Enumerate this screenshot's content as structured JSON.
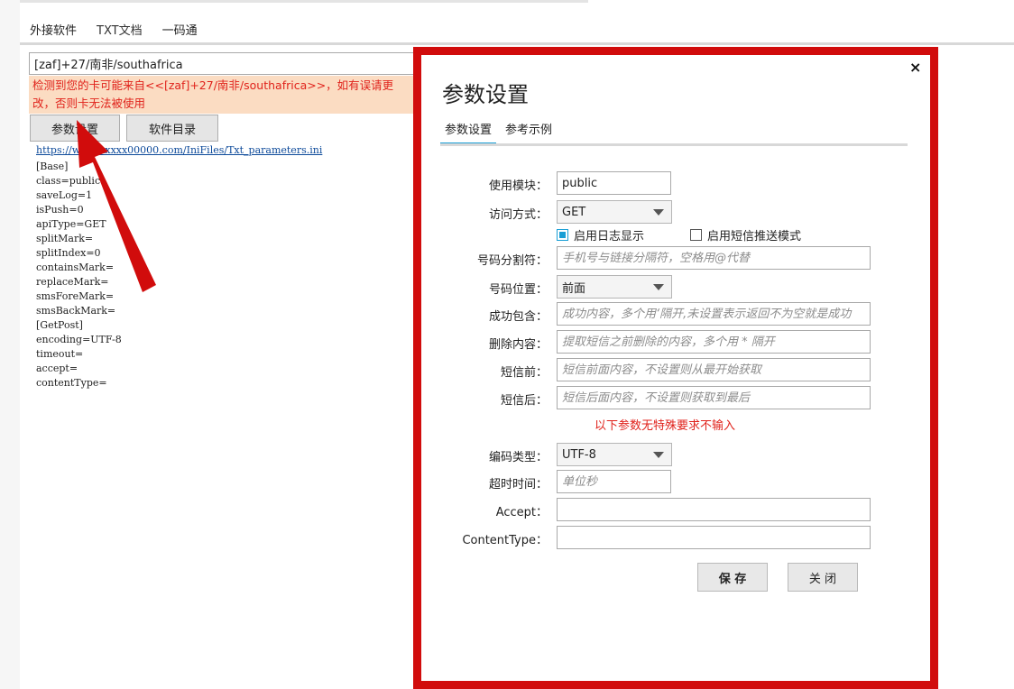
{
  "tabs": [
    "外接软件",
    "TXT文档",
    "一码通"
  ],
  "left_panel": {
    "source_value": "[zaf]+27/南非/southafrica",
    "warning_text": "检测到您的卡可能来自<<[zaf]+27/南非/southafrica>>，如有误请更改，否则卡无法被使用",
    "param_button": "参数设置",
    "dir_button": "软件目录",
    "config_link": "https://www.xxxxx00000.com/IniFiles/Txt_parameters.ini",
    "ini_lines": [
      "[Base]",
      "class=public",
      "saveLog=1",
      "isPush=0",
      "apiType=GET",
      "splitMark=",
      "splitIndex=0",
      "containsMark=",
      "replaceMark=",
      "smsForeMark=",
      "smsBackMark=",
      "[GetPost]",
      "encoding=UTF-8",
      "timeout=",
      "accept=",
      "contentType="
    ]
  },
  "dialog": {
    "title": "参数设置",
    "close_glyph": "×",
    "tabs": [
      "参数设置",
      "参考示例"
    ],
    "labels": {
      "module": "使用模块：",
      "method": "访问方式：",
      "split": "号码分割符：",
      "position": "号码位置：",
      "contains": "成功包含：",
      "remove": "删除内容：",
      "before": "短信前：",
      "after": "短信后：",
      "encoding": "编码类型：",
      "timeout": "超时时间：",
      "accept": "Accept：",
      "content_type": "ContentType："
    },
    "values": {
      "module": "public",
      "method": "GET",
      "position": "前面",
      "encoding": "UTF-8",
      "accept": "",
      "content_type": ""
    },
    "placeholders": {
      "split": "手机号与链接分隔符，空格用@代替",
      "contains": "成功内容，多个用‘隔开,未设置表示返回不为空就是成功",
      "remove": "提取短信之前删除的内容，多个用 * 隔开",
      "before": "短信前面内容，不设置则从最开始获取",
      "after": "短信后面内容，不设置则获取到最后",
      "timeout": "单位秒"
    },
    "checkbox_log": "启用日志显示",
    "checkbox_log_checked": true,
    "checkbox_push": "启用短信推送模式",
    "checkbox_push_checked": false,
    "note": "以下参数无特殊要求不输入",
    "save_button": "保 存",
    "close_button": "关 闭"
  },
  "colors": {
    "accent": "#1a9fd5",
    "highlight_red": "#d10c0c",
    "warning_bg": "#fbdcc2",
    "warning_text": "#e0221b"
  }
}
